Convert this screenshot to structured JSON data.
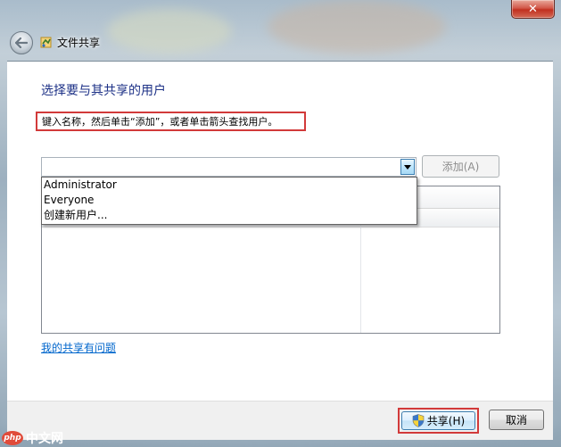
{
  "window": {
    "title": "文件共享",
    "close_glyph": "✕"
  },
  "dialog": {
    "heading": "选择要与其共享的用户",
    "instruction": "键入名称，然后单击“添加”，或者单击箭头查找用户。",
    "add_button": "添加(A)",
    "user_input_value": "",
    "dropdown_options": [
      "Administrator",
      "Everyone",
      "创建新用户..."
    ],
    "help_link": "我的共享有问题"
  },
  "footer": {
    "share_button": "共享(H)",
    "cancel_button": "取消"
  },
  "watermark": {
    "logo_text": "php",
    "text": "中文网"
  },
  "colors": {
    "heading": "#1e3287",
    "highlight_border": "#d23a3a",
    "link": "#0066cc"
  },
  "icons": {
    "back": "back-arrow-icon",
    "app": "file-sharing-icon",
    "dropdown": "chevron-down-icon",
    "shield": "uac-shield-icon"
  }
}
